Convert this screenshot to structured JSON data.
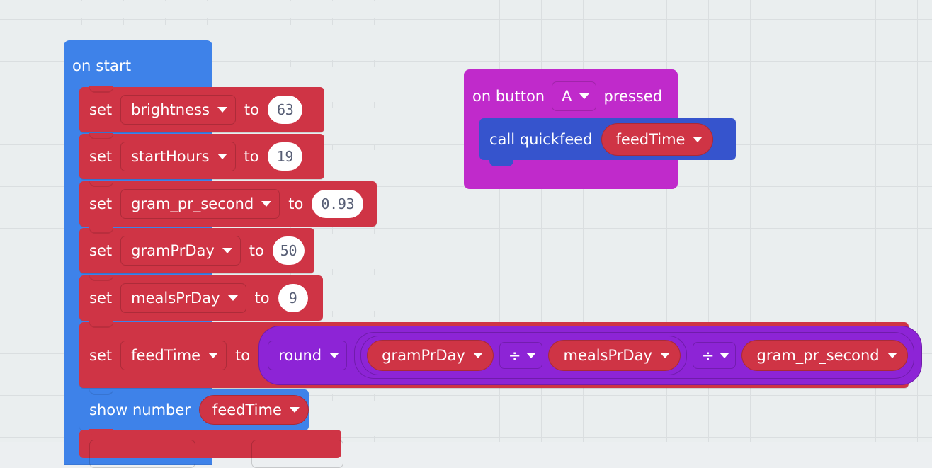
{
  "app": {
    "type": "block-editor-workspace",
    "background_color": "#EAEEEF",
    "grid_color": "#DADEE0"
  },
  "colors": {
    "event_blue": "#3E82E9",
    "variable_red": "#CF3445",
    "math_purple": "#8D24D6",
    "input_magenta": "#C02ACB",
    "function_blue": "#3654CD",
    "field_text": "#575E75",
    "block_text": "#FFFFFF"
  },
  "scripts": [
    {
      "name": "on-start-script",
      "hat": {
        "label": "on start",
        "color": "#3E82E9"
      },
      "statements": [
        {
          "kind": "set-variable",
          "set_label": "set",
          "variable": "brightness",
          "to_label": "to",
          "value": "63",
          "value_kind": "number"
        },
        {
          "kind": "set-variable",
          "set_label": "set",
          "variable": "startHours",
          "to_label": "to",
          "value": "19",
          "value_kind": "number"
        },
        {
          "kind": "set-variable",
          "set_label": "set",
          "variable": "gram_pr_second",
          "to_label": "to",
          "value": "0.93",
          "value_kind": "number"
        },
        {
          "kind": "set-variable",
          "set_label": "set",
          "variable": "gramPrDay",
          "to_label": "to",
          "value": "50",
          "value_kind": "number"
        },
        {
          "kind": "set-variable",
          "set_label": "set",
          "variable": "mealsPrDay",
          "to_label": "to",
          "value": "9",
          "value_kind": "number"
        },
        {
          "kind": "set-variable-expression",
          "set_label": "set",
          "variable": "feedTime",
          "to_label": "to",
          "expression": {
            "op": "round",
            "operand": {
              "op": "÷",
              "left": {
                "op": "÷",
                "left": {
                  "variable": "gramPrDay"
                },
                "right": {
                  "variable": "mealsPrDay"
                }
              },
              "right": {
                "variable": "gram_pr_second"
              }
            }
          }
        },
        {
          "kind": "show-number",
          "label": "show number",
          "variable": "feedTime",
          "color": "#3E82E9"
        },
        {
          "kind": "clipped-statement",
          "label": ""
        }
      ]
    },
    {
      "name": "on-button-pressed-script",
      "hat": {
        "prefix_label": "on button",
        "button": "A",
        "suffix_label": "pressed",
        "color": "#C02ACB"
      },
      "statements": [
        {
          "kind": "call-function",
          "label": "call quickfeed",
          "argument": "feedTime",
          "color": "#3654CD"
        }
      ]
    }
  ],
  "icons": {
    "dropdown_caret": "chevron-down-icon"
  }
}
